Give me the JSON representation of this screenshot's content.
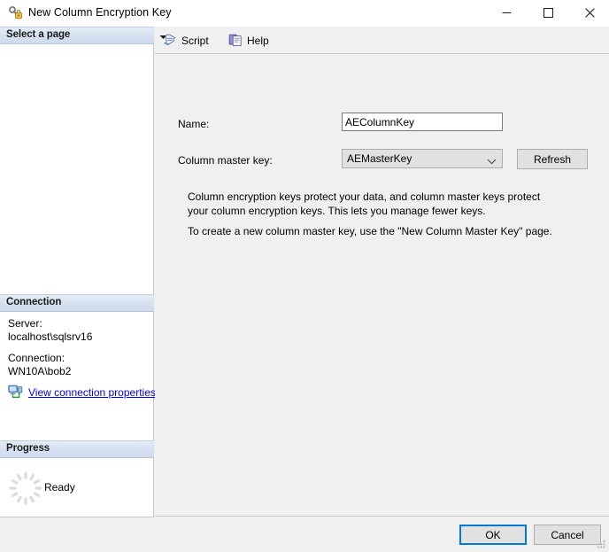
{
  "window": {
    "title": "New Column Encryption Key",
    "icon": "key-lock-icon",
    "minimize_label": "—",
    "maximize_label": "☐",
    "close_label": "✕"
  },
  "toolbar": {
    "script_label": "Script",
    "script_icon": "script-scroll-icon",
    "script_dropdown_icon": "chevron-down-icon",
    "help_label": "Help",
    "help_icon": "help-pages-icon"
  },
  "sidebar": {
    "select_page_header": "Select a page",
    "connection": {
      "header": "Connection",
      "server_label": "Server:",
      "server_value": "localhost\\sqlsrv16",
      "connection_label": "Connection:",
      "connection_value": "WN10A\\bob2",
      "properties_link": "View connection properties",
      "properties_icon": "server-connection-icon"
    },
    "progress": {
      "header": "Progress",
      "status": "Ready",
      "spinner_icon": "loading-spinner-icon"
    }
  },
  "form": {
    "name_label": "Name:",
    "name_value": "AEColumnKey",
    "name_placeholder": "",
    "master_key_label": "Column master key:",
    "master_key_value": "AEMasterKey",
    "master_key_options": [
      "AEMasterKey"
    ],
    "refresh_label": "Refresh",
    "description_1": "Column encryption keys protect your data, and column master keys protect your column encryption keys. This lets you manage fewer keys.",
    "description_2": "To create a new column master key, use the \"New Column Master Key\" page."
  },
  "footer": {
    "ok_label": "OK",
    "cancel_label": "Cancel"
  },
  "colors": {
    "accent": "#0078d7",
    "link": "#0000ee",
    "panel_header_start": "#e4ecf7",
    "panel_header_end": "#cfdcee",
    "dialog_bg": "#f0f0f0",
    "control_bg": "#e1e1e1"
  }
}
